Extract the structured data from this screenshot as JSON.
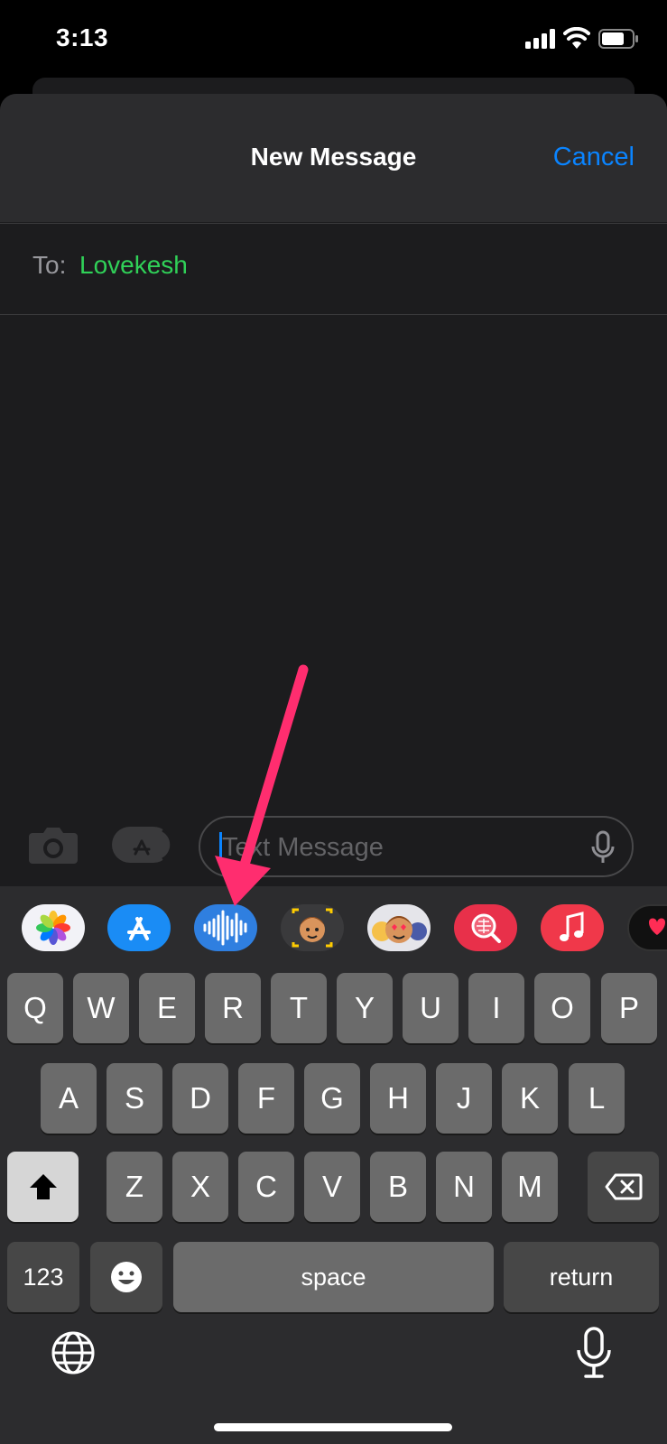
{
  "status_bar": {
    "time": "3:13"
  },
  "sheet": {
    "title": "New Message",
    "cancel_label": "Cancel"
  },
  "to_field": {
    "label": "To:",
    "recipient": "Lovekesh"
  },
  "compose": {
    "placeholder": "Text Message"
  },
  "app_drawer": {
    "apps": [
      "photos-app",
      "app-store-app",
      "audio-message-app",
      "memoji-app",
      "animoji-stickers-app",
      "images-search-app",
      "music-app",
      "digital-touch-app"
    ]
  },
  "keyboard": {
    "row1": [
      "Q",
      "W",
      "E",
      "R",
      "T",
      "Y",
      "U",
      "I",
      "O",
      "P"
    ],
    "row2": [
      "A",
      "S",
      "D",
      "F",
      "G",
      "H",
      "J",
      "K",
      "L"
    ],
    "row3": [
      "Z",
      "X",
      "C",
      "V",
      "B",
      "N",
      "M"
    ],
    "numbers_label": "123",
    "space_label": "space",
    "return_label": "return"
  },
  "colors": {
    "accent": "#0a84ff",
    "recipient": "#30d158",
    "annotation_arrow": "#ff2d6f"
  }
}
